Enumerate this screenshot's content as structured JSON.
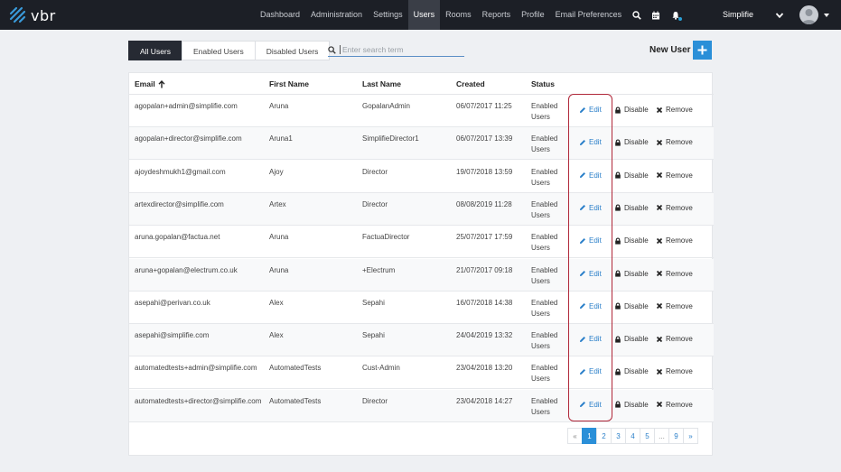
{
  "brand": {
    "name": "vbr"
  },
  "nav": {
    "items": [
      {
        "label": "Dashboard",
        "active": false
      },
      {
        "label": "Administration",
        "active": false
      },
      {
        "label": "Settings",
        "active": false
      },
      {
        "label": "Users",
        "active": true
      },
      {
        "label": "Rooms",
        "active": false
      },
      {
        "label": "Reports",
        "active": false
      },
      {
        "label": "Profile",
        "active": false
      },
      {
        "label": "Email Preferences",
        "active": false
      }
    ],
    "icons": [
      "search-icon",
      "calendar-icon",
      "bell-icon"
    ],
    "account_name": "Simplifie"
  },
  "filters": {
    "tabs": [
      {
        "label": "All Users",
        "active": true
      },
      {
        "label": "Enabled Users",
        "active": false
      },
      {
        "label": "Disabled Users",
        "active": false
      }
    ],
    "search_placeholder": "Enter search term",
    "new_user_label": "New User"
  },
  "table": {
    "headers": {
      "email": "Email",
      "first_name": "First Name",
      "last_name": "Last Name",
      "created": "Created",
      "status": "Status"
    },
    "action_labels": {
      "edit": "Edit",
      "disable": "Disable",
      "remove": "Remove"
    },
    "rows": [
      {
        "email": "agopalan+admin@simplifie.com",
        "first": "Aruna",
        "last": "GopalanAdmin",
        "created": "06/07/2017 11:25",
        "status": "Enabled Users"
      },
      {
        "email": "agopalan+director@simplifie.com",
        "first": "Aruna1",
        "last": "SimplifieDirector1",
        "created": "06/07/2017 13:39",
        "status": "Enabled Users"
      },
      {
        "email": "ajoydeshmukh1@gmail.com",
        "first": "Ajoy",
        "last": "Director",
        "created": "19/07/2018 13:59",
        "status": "Enabled Users"
      },
      {
        "email": "artexdirector@simplifie.com",
        "first": "Artex",
        "last": "Director",
        "created": "08/08/2019 11:28",
        "status": "Enabled Users"
      },
      {
        "email": "aruna.gopalan@factua.net",
        "first": "Aruna",
        "last": "FactuaDirector",
        "created": "25/07/2017 17:59",
        "status": "Enabled Users"
      },
      {
        "email": "aruna+gopalan@electrum.co.uk",
        "first": "Aruna",
        "last": "+Electrum",
        "created": "21/07/2017 09:18",
        "status": "Enabled Users"
      },
      {
        "email": "asepahi@perivan.co.uk",
        "first": "Alex",
        "last": "Sepahi",
        "created": "16/07/2018 14:38",
        "status": "Enabled Users"
      },
      {
        "email": "asepahi@simplifie.com",
        "first": "Alex",
        "last": "Sepahi",
        "created": "24/04/2019 13:32",
        "status": "Enabled Users"
      },
      {
        "email": "automatedtests+admin@simplifie.com",
        "first": "AutomatedTests",
        "last": "Cust-Admin",
        "created": "23/04/2018 13:20",
        "status": "Enabled Users"
      },
      {
        "email": "automatedtests+director@simplifie.com",
        "first": "AutomatedTests",
        "last": "Director",
        "created": "23/04/2018 14:27",
        "status": "Enabled Users"
      }
    ]
  },
  "pagination": {
    "prev": "«",
    "pages": [
      "1",
      "2",
      "3",
      "4",
      "5",
      "...",
      "9"
    ],
    "active": "1",
    "next": "»"
  },
  "colors": {
    "nav_bg": "#1c1f26",
    "accent": "#2a8fd8",
    "highlight": "#b0283a"
  }
}
